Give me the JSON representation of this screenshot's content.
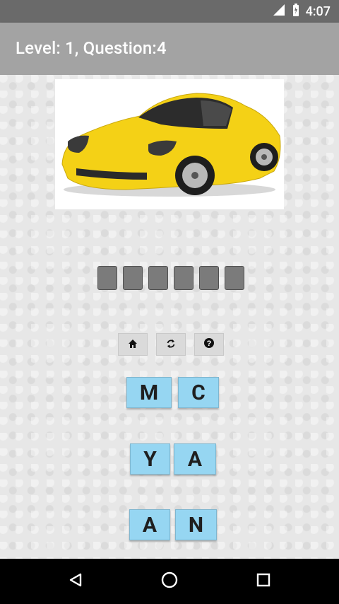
{
  "status_bar": {
    "time": "4:07"
  },
  "toolbar": {
    "title": "Level: 1, Question:4"
  },
  "puzzle": {
    "slots": 6
  },
  "controls": [
    {
      "icon": "home-icon"
    },
    {
      "icon": "refresh-icon"
    },
    {
      "icon": "help-icon"
    }
  ],
  "tiles": [
    {
      "letter": "M"
    },
    {
      "letter": "C"
    },
    {
      "letter": "Y"
    },
    {
      "letter": "A"
    },
    {
      "letter": "A"
    },
    {
      "letter": "N"
    }
  ],
  "colors": {
    "toolbar": "#a3a3a3",
    "tile": "#96d6f2",
    "car": "#f4d116"
  }
}
